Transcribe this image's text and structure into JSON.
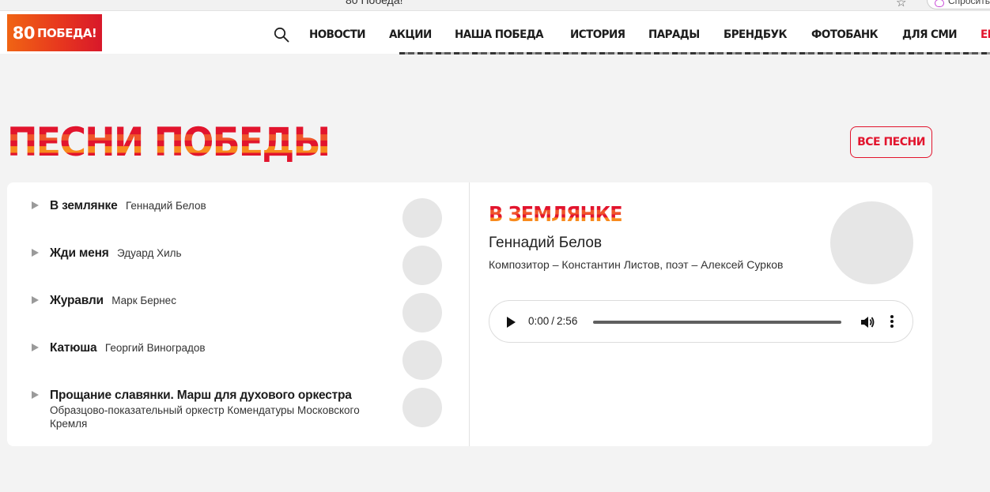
{
  "browser": {
    "tab_title": "80 Победа!",
    "pill_label": "Спросить"
  },
  "header": {
    "logo_number": "80",
    "logo_word": "ПОБЕДА!",
    "nav": [
      {
        "label": "НОВОСТИ"
      },
      {
        "label": "АКЦИИ"
      },
      {
        "label": "НАША ПОБЕДА"
      },
      {
        "label": "ИСТОРИЯ"
      },
      {
        "label": "ПАРАДЫ"
      },
      {
        "label": "БРЕНДБУК"
      },
      {
        "label": "ФОТОБАНК"
      },
      {
        "label": "ДЛЯ СМИ"
      },
      {
        "label": "EN"
      }
    ]
  },
  "colors": {
    "accent": "#e2142d",
    "accent_orange": "#f06414",
    "background": "#f3f3f3"
  },
  "section": {
    "title": "ПЕСНИ ПОБЕДЫ",
    "all_songs_label": "ВСЕ ПЕСНИ"
  },
  "songs": [
    {
      "title": "В землянке",
      "artist": "Геннадий Белов"
    },
    {
      "title": "Жди меня",
      "artist": "Эдуард Хиль"
    },
    {
      "title": "Журавли",
      "artist": "Марк Бернес"
    },
    {
      "title": "Катюша",
      "artist": "Георгий Виноградов"
    },
    {
      "title": "Прощание славянки. Марш для духового оркестра",
      "artist": "Образцово-показательный оркестр Комендатуры Московского Кремля"
    }
  ],
  "detail": {
    "title": "В ЗЕМЛЯНКЕ",
    "artist": "Геннадий Белов",
    "credits": "Композитор – Константин Листов, поэт – Алексей Сурков"
  },
  "player": {
    "current_time": "0:00",
    "separator": "/",
    "duration": "2:56",
    "progress": 0
  }
}
